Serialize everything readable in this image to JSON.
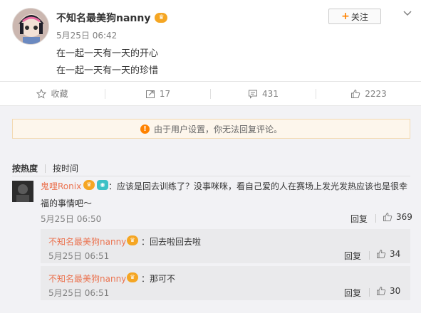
{
  "post": {
    "username": "不知名最美狗nanny",
    "time": "5月25日 06:42",
    "lines": [
      "在一起一天有一天的开心",
      "在一起一天有一天的珍惜"
    ],
    "follow_label": "关注"
  },
  "actions": {
    "favorite": "收藏",
    "repost": "17",
    "comment": "431",
    "like": "2223"
  },
  "notice": "由于用户设置，你无法回复评论。",
  "sort": {
    "hot": "按热度",
    "time": "按时间"
  },
  "comment": {
    "username": "鬼哩Ronix",
    "text_line1": "：应该是回去训练了？没事咪咪，看自己爱的人在赛场上发光发热应该也是很幸",
    "text_line2": "福的事情吧～",
    "time": "5月25日 06:50",
    "reply_label": "回复",
    "likes": "369"
  },
  "replies": [
    {
      "username": "不知名最美狗nanny",
      "text": "：回去啦回去啦",
      "time": "5月25日 06:51",
      "reply_label": "回复",
      "likes": "34"
    },
    {
      "username": "不知名最美狗nanny",
      "text": "：那可不",
      "time": "5月25日 06:51",
      "reply_label": "回复",
      "likes": "30"
    }
  ],
  "colors": {
    "accent": "#ff8200",
    "username": "#eb7350",
    "comment_bg": "#f2f2f5"
  }
}
